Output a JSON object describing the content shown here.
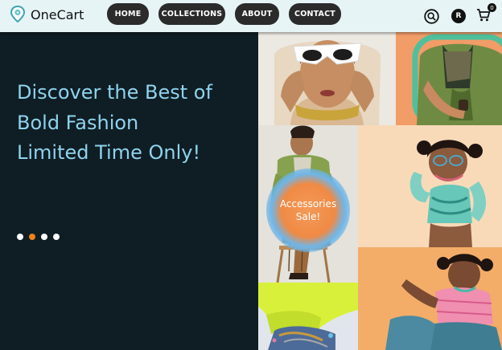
{
  "brand": {
    "name": "OneCart",
    "logo_icon": "map-pin-logo-icon"
  },
  "nav": {
    "items": [
      {
        "label": "HOME"
      },
      {
        "label": "COLLECTIONS"
      },
      {
        "label": "ABOUT"
      },
      {
        "label": "CONTACT"
      }
    ]
  },
  "header_actions": {
    "search_icon": "search-icon",
    "avatar_initial": "R",
    "cart_icon": "shopping-cart-icon",
    "cart_count": "0"
  },
  "hero": {
    "lines": [
      "Discover the Best of",
      "Bold Fashion",
      "Limited Time Only!"
    ],
    "slide_count": 4,
    "active_slide": 2
  },
  "promo_badge": {
    "line1": "Accessories",
    "line2": "Sale!"
  },
  "gallery": {
    "images": [
      "woman-white-sunglasses-photo",
      "green-jacket-accessories-photo",
      "green-blazer-plaid-pants-photo",
      "teal-outfit-glasses-photo",
      "yellow-jacket-jewelry-photo",
      "pink-outfit-denim-photo"
    ]
  },
  "colors": {
    "accent": "#f0801d",
    "hero_text": "#8fd3ee",
    "hero_bg": "#0f1e24",
    "nav_bg": "#e6f4f6"
  }
}
